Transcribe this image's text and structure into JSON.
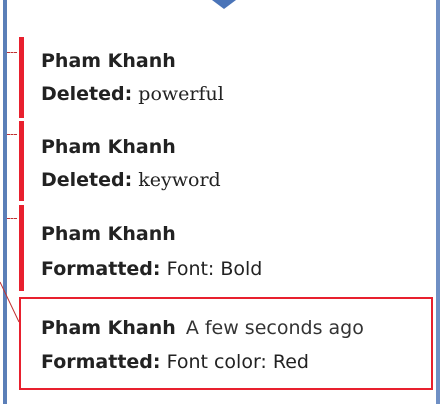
{
  "comments": [
    {
      "author": "Pham Khanh",
      "action": "Deleted:",
      "detail": "powerful",
      "time": ""
    },
    {
      "author": "Pham Khanh",
      "action": "Deleted:",
      "detail": "keyword",
      "time": ""
    },
    {
      "author": "Pham Khanh",
      "action": "Formatted:",
      "detail": "Font: Bold",
      "time": ""
    },
    {
      "author": "Pham Khanh",
      "action": "Formatted:",
      "detail": "Font color: Red",
      "time": "A few seconds ago"
    }
  ],
  "colors": {
    "markup_red": "#e8202e",
    "pane_blue": "#5b7fb8",
    "text": "#222222"
  }
}
